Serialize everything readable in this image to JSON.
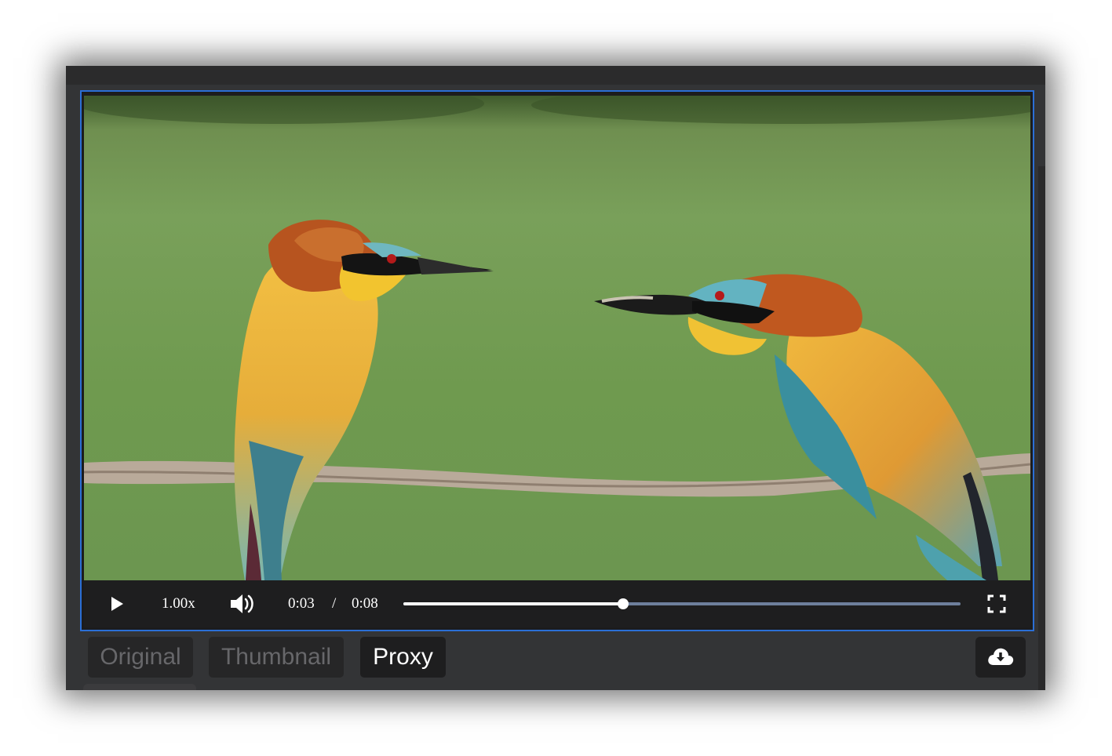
{
  "player": {
    "speed_label": "1.00x",
    "current_time": "0:03",
    "time_separator": "/",
    "duration": "0:08",
    "progress": 0.3944,
    "state": "paused",
    "icons": {
      "play": "play-icon",
      "volume": "volume-icon",
      "fullscreen": "fullscreen-icon"
    }
  },
  "rendition_tabs": [
    {
      "label": "Original",
      "active": false
    },
    {
      "label": "Thumbnail",
      "active": false
    },
    {
      "label": "Proxy",
      "active": true
    }
  ],
  "download": {
    "icon": "cloud-download-icon"
  },
  "colors": {
    "focus_border": "#2b6fd6",
    "seek_track": "#6e7f9c",
    "seek_fill": "#ffffff"
  }
}
